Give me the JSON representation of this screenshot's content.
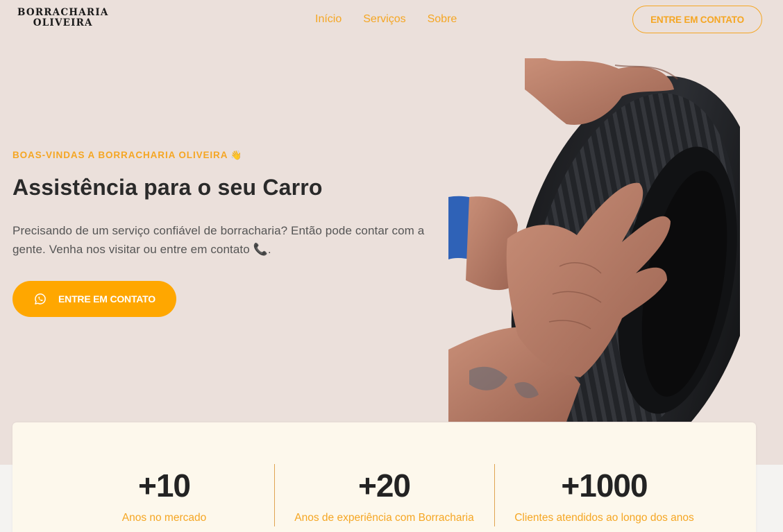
{
  "brand": {
    "line1": "BORRACHARIA",
    "line2": "OLIVEIRA"
  },
  "nav": {
    "items": [
      "Início",
      "Serviços",
      "Sobre"
    ],
    "cta_label": "ENTRE EM CONTATO"
  },
  "hero": {
    "eyebrow": "BOAS-VINDAS A BORRACHARIA OLIVEIRA",
    "eyebrow_emoji": "👋",
    "headline": "Assistência para o seu Carro",
    "description": "Precisando de um serviço confiável de borracharia? Então pode contar com a gente. Venha nos visitar ou entre em contato",
    "description_emoji": "📞",
    "description_end": ".",
    "cta_label": "ENTRE EM CONTATO",
    "cta_icon": "whatsapp-icon",
    "image": "hands-holding-tire"
  },
  "stats": [
    {
      "value": "+10",
      "label": "Anos no mercado"
    },
    {
      "value": "+20",
      "label": "Anos de experiência com Borracharia"
    },
    {
      "value": "+1000",
      "label": "Clientes atendidos ao longo dos anos"
    }
  ],
  "colors": {
    "accent": "#ffa700",
    "accent_text": "#f5a623",
    "hero_bg": "#ebe0db",
    "stats_bg": "#fdf8ec"
  }
}
